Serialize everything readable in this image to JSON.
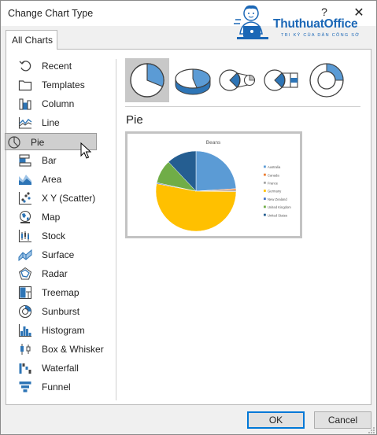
{
  "window": {
    "title": "Change Chart Type",
    "help_label": "?",
    "close_label": "✕"
  },
  "logo": {
    "name": "ThuthuatOffice",
    "tagline": "TRI KỶ CỦA DÂN CÔNG SỞ",
    "icon": "person-at-laptop-icon"
  },
  "tabs": [
    {
      "label": "All Charts",
      "active": true
    }
  ],
  "sidebar": {
    "selected": "Pie",
    "items": [
      {
        "label": "Recent",
        "icon": "recent-icon"
      },
      {
        "label": "Templates",
        "icon": "folder-icon"
      },
      {
        "label": "Column",
        "icon": "column-chart-icon"
      },
      {
        "label": "Line",
        "icon": "line-chart-icon"
      },
      {
        "label": "Pie",
        "icon": "pie-chart-icon"
      },
      {
        "label": "Bar",
        "icon": "bar-chart-icon"
      },
      {
        "label": "Area",
        "icon": "area-chart-icon"
      },
      {
        "label": "X Y (Scatter)",
        "icon": "scatter-chart-icon"
      },
      {
        "label": "Map",
        "icon": "map-chart-icon"
      },
      {
        "label": "Stock",
        "icon": "stock-chart-icon"
      },
      {
        "label": "Surface",
        "icon": "surface-chart-icon"
      },
      {
        "label": "Radar",
        "icon": "radar-chart-icon"
      },
      {
        "label": "Treemap",
        "icon": "treemap-chart-icon"
      },
      {
        "label": "Sunburst",
        "icon": "sunburst-chart-icon"
      },
      {
        "label": "Histogram",
        "icon": "histogram-chart-icon"
      },
      {
        "label": "Box & Whisker",
        "icon": "box-whisker-chart-icon"
      },
      {
        "label": "Waterfall",
        "icon": "waterfall-chart-icon"
      },
      {
        "label": "Funnel",
        "icon": "funnel-chart-icon"
      }
    ]
  },
  "subtypes": [
    {
      "icon": "pie-subtype-icon",
      "selected": true
    },
    {
      "icon": "pie-3d-subtype-icon",
      "selected": false
    },
    {
      "icon": "pie-of-pie-subtype-icon",
      "selected": false
    },
    {
      "icon": "bar-of-pie-subtype-icon",
      "selected": false
    },
    {
      "icon": "doughnut-subtype-icon",
      "selected": false
    }
  ],
  "section_title": "Pie",
  "colors": {
    "accent": "#0078d7",
    "icon_blue": "#2e75b6",
    "selection": "#cfcfcf"
  },
  "chart_data": {
    "type": "pie",
    "title": "Beans",
    "legend_position": "right",
    "categories": [
      "Australia",
      "Canada",
      "France",
      "Germany",
      "New Zealand",
      "United Kingdom",
      "United States"
    ],
    "values": [
      24,
      0.6,
      0.6,
      52.8,
      0.4,
      9.6,
      12
    ],
    "colors": [
      "#5b9bd5",
      "#ed7d31",
      "#a5a5a5",
      "#ffc000",
      "#4472c4",
      "#70ad47",
      "#255e91"
    ]
  },
  "buttons": {
    "ok": "OK",
    "cancel": "Cancel"
  }
}
